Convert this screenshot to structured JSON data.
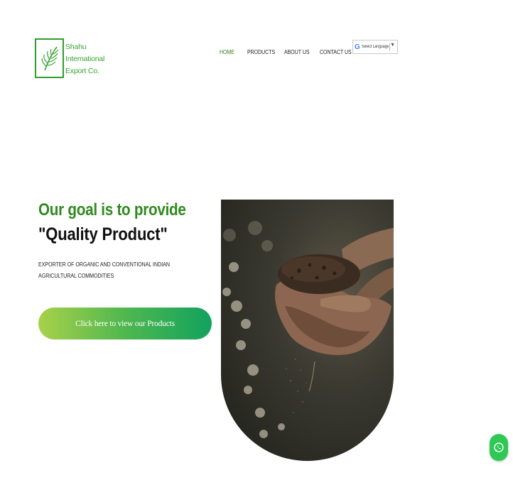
{
  "brand": {
    "line1": "Shahu",
    "line2": "International",
    "line3": "Export Co.",
    "color": "#3aa535"
  },
  "nav": {
    "items": [
      {
        "label": "HOME",
        "active": true
      },
      {
        "label": "PRODUCTS",
        "active": false
      },
      {
        "label": "ABOUT US",
        "active": false
      },
      {
        "label": "CONTACT US",
        "active": false
      }
    ]
  },
  "language": {
    "label": "Select Language",
    "icon": "google-g-icon"
  },
  "hero": {
    "headline": "Our goal is to provide",
    "headline_quote": "\"Quality Product\"",
    "subtitle": "EXPORTER OF ORGANIC AND CONVENTIONAL INDIAN AGRICULTURAL COMMODITIES",
    "cta_label": "Click here to view our Products",
    "accent_color": "#2f8a1e"
  },
  "floating": {
    "whatsapp_icon": "whatsapp-icon",
    "color": "#2ec955"
  }
}
